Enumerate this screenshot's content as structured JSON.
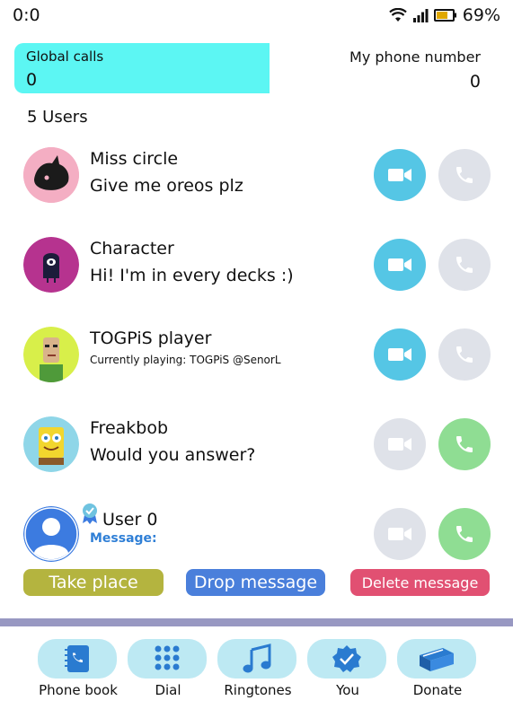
{
  "status": {
    "time": "0:0",
    "battery": "69%"
  },
  "header": {
    "global_calls_label": "Global calls",
    "global_calls_value": "0",
    "my_number_label": "My phone number",
    "my_number_value": "0"
  },
  "users_count": "5 Users",
  "users": [
    {
      "name": "Miss circle",
      "message": "Give me oreos plz",
      "video": "available",
      "voice": "unavailable"
    },
    {
      "name": "Character",
      "message": "Hi! I'm in every decks :)",
      "video": "available",
      "voice": "unavailable"
    },
    {
      "name": "TOGPiS player",
      "message": "Currently playing: TOGPiS @SenorL",
      "video": "available",
      "voice": "unavailable"
    },
    {
      "name": "Freakbob",
      "message": "Would you answer?",
      "video": "unavailable",
      "voice": "available"
    }
  ],
  "self_user": {
    "name": "User 0",
    "message_label": "Message:"
  },
  "actions": {
    "take_place": "Take place",
    "drop_message": "Drop message",
    "delete_message": "Delete message"
  },
  "nav": [
    {
      "label": "Phone book",
      "icon": "phone-book-icon"
    },
    {
      "label": "Dial",
      "icon": "dial-pad-icon"
    },
    {
      "label": "Ringtones",
      "icon": "music-note-icon"
    },
    {
      "label": "You",
      "icon": "verified-badge-icon"
    },
    {
      "label": "Donate",
      "icon": "donate-box-icon"
    }
  ],
  "colors": {
    "accent_cyan": "#5cf6f3",
    "video_blue": "#55c6e5",
    "disabled_grey": "#dfe2e9",
    "voice_green": "#8fdd93",
    "take_place": "#b4b43f",
    "drop_message": "#4a7fdb",
    "delete_message": "#e15072",
    "divider": "#9898c2",
    "nav_pill": "#bde9f3"
  }
}
